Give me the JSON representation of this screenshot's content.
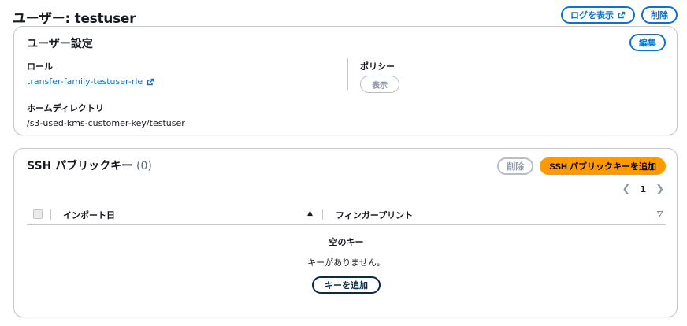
{
  "header": {
    "title": "ユーザー: testuser",
    "view_logs_label": "ログを表示",
    "delete_label": "削除"
  },
  "user_settings": {
    "title": "ユーザー設定",
    "edit_label": "編集",
    "role_label": "ロール",
    "role_value": "transfer-family-testuser-rle",
    "policy_label": "ポリシー",
    "policy_button": "表示",
    "home_label": "ホームディレクトリ",
    "home_value": "/s3-used-kms-customer-key/testuser"
  },
  "ssh_keys": {
    "title": "SSH パブリックキー",
    "count": "(0)",
    "delete_label": "削除",
    "add_label": "SSH パブリックキーを追加",
    "page": "1",
    "columns": [
      "インポート日",
      "フィンガープリント"
    ],
    "empty_title": "空のキー",
    "empty_message": "キーがありません。",
    "empty_add_label": "キーを追加"
  },
  "colors": {
    "link": "#0972d3",
    "primary": "#ff9900",
    "border": "#c6c6cd"
  }
}
